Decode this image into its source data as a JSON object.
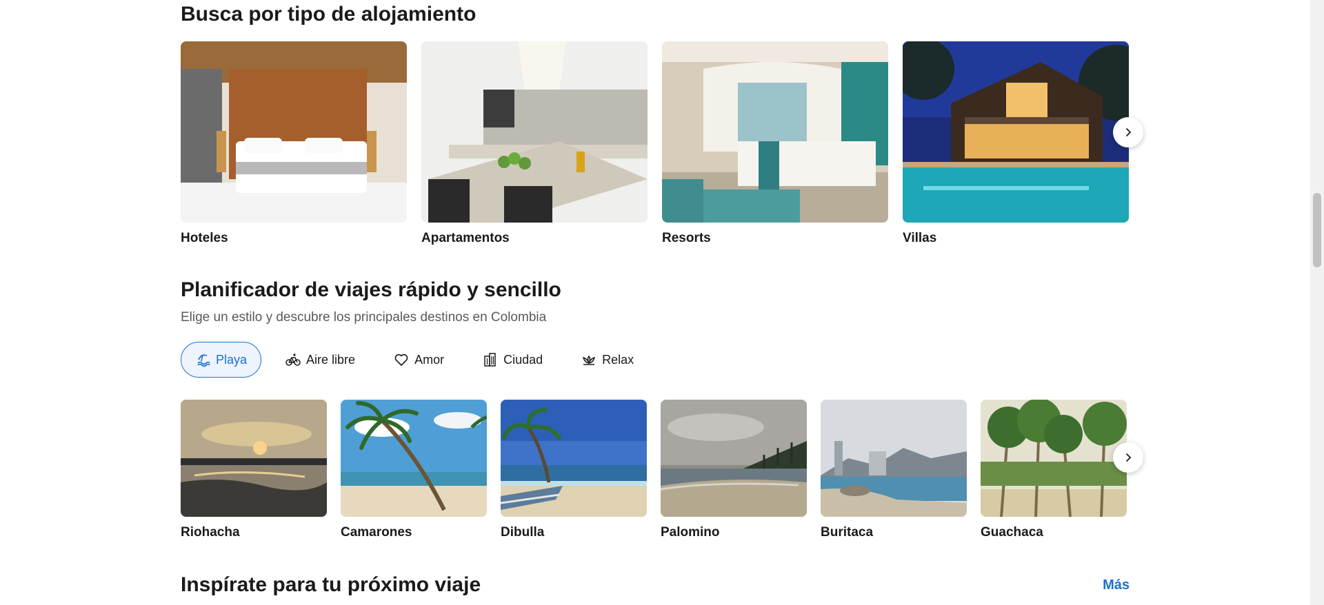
{
  "section_types": {
    "title": "Busca por tipo de alojamiento",
    "cards": [
      {
        "label": "Hoteles"
      },
      {
        "label": "Apartamentos"
      },
      {
        "label": "Resorts"
      },
      {
        "label": "Villas"
      }
    ]
  },
  "section_planner": {
    "title": "Planificador de viajes rápido y sencillo",
    "subtitle": "Elige un estilo y descubre los principales destinos en Colombia",
    "chips": [
      {
        "label": "Playa",
        "icon": "beach-icon",
        "active": true
      },
      {
        "label": "Aire libre",
        "icon": "bicycle-icon",
        "active": false
      },
      {
        "label": "Amor",
        "icon": "heart-icon",
        "active": false
      },
      {
        "label": "Ciudad",
        "icon": "buildings-icon",
        "active": false
      },
      {
        "label": "Relax",
        "icon": "lotus-icon",
        "active": false
      }
    ],
    "destinations": [
      {
        "label": "Riohacha"
      },
      {
        "label": "Camarones"
      },
      {
        "label": "Dibulla"
      },
      {
        "label": "Palomino"
      },
      {
        "label": "Buritaca"
      },
      {
        "label": "Guachaca"
      }
    ]
  },
  "section_inspire": {
    "title": "Inspírate para tu próximo viaje",
    "more_label": "Más"
  },
  "colors": {
    "accent": "#1a6fd1",
    "text": "#1a1a1a",
    "subtle_text": "#595959"
  }
}
